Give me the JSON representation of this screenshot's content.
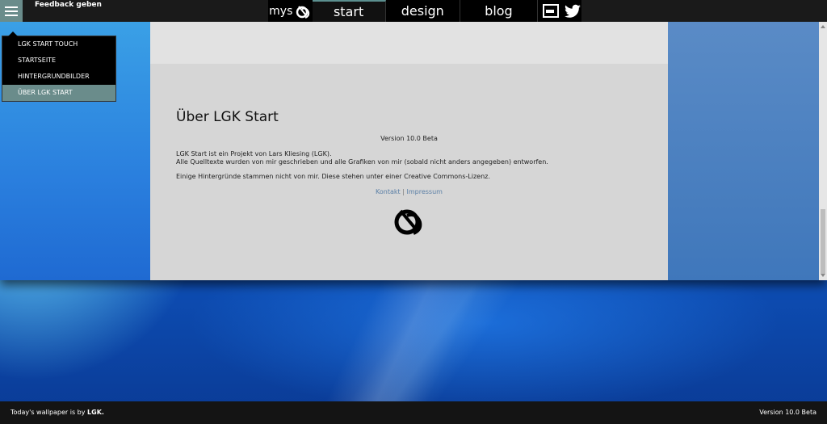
{
  "topbar": {
    "feedback_label": "Feedback geben",
    "brand_label": "mys",
    "tabs": [
      {
        "label": "start"
      },
      {
        "label": "design"
      },
      {
        "label": "blog"
      }
    ],
    "social_icons": [
      "bookmark-image-icon",
      "twitter-icon"
    ]
  },
  "menu": {
    "items": [
      {
        "label": "LGK START TOUCH"
      },
      {
        "label": "STARTSEITE"
      },
      {
        "label": "HINTERGRUNDBILDER"
      },
      {
        "label": "ÜBER LGK START"
      }
    ],
    "active_index": 3
  },
  "about": {
    "title": "Über LGK Start",
    "version": "Version 10.0 Beta",
    "line1": "LGK Start ist ein Projekt von Lars Kliesing (LGK).",
    "line2": "Alle Quelltexte wurden von mir geschrieben und alle Grafiken von mir (sobald nicht anders angegeben) entworfen.",
    "line3": "Einige Hintergründe stammen nicht von mir. Diese stehen unter einer Creative Commons-Lizenz.",
    "link_contact": "Kontakt",
    "link_separator": "|",
    "link_imprint": "Impressum"
  },
  "footer": {
    "wallpaper_prefix": "Today's wallpaper is by",
    "wallpaper_author": "LGK.",
    "version": "Version 10.0 Beta"
  },
  "colors": {
    "accent": "#6a8c8b",
    "topbar": "#1a1a1a",
    "link": "#5a7fa6"
  }
}
